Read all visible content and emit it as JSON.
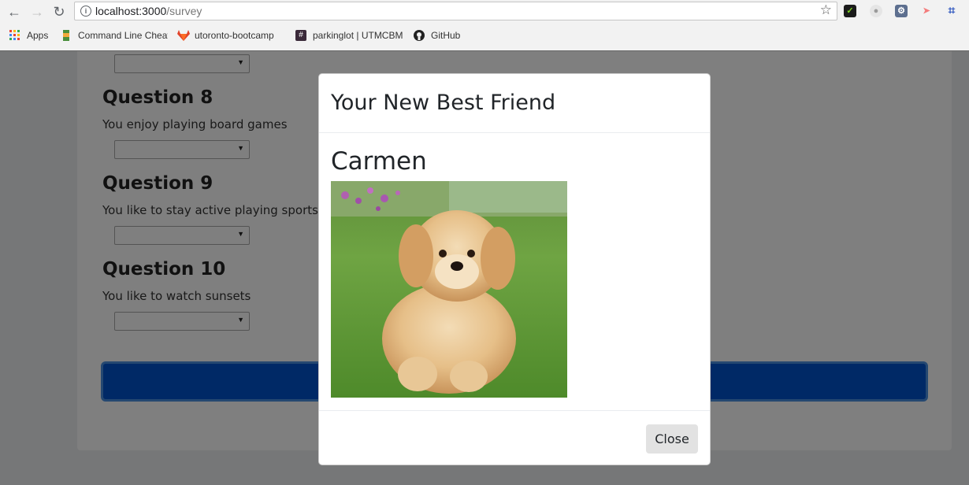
{
  "browser": {
    "url_host": "localhost:3000",
    "url_path": "/survey",
    "bookmarks": [
      {
        "label": "Apps",
        "icon": "apps-grid-icon"
      },
      {
        "label": "Command Line Cheat",
        "icon": "bookmark-icon"
      },
      {
        "label": "utoronto-bootcamp",
        "icon": "gitlab-icon"
      },
      {
        "label": "parkinglot | UTMCBM",
        "icon": "slack-hash-icon"
      },
      {
        "label": "GitHub",
        "icon": "github-icon"
      }
    ],
    "colors": {
      "toolbar": "#f2f2f2",
      "omnibox_border": "#c5c5c5"
    }
  },
  "survey": {
    "questions": [
      {
        "title": "Question 8",
        "text": "You enjoy playing board games"
      },
      {
        "title": "Question 9",
        "text": "You like to stay active playing sports"
      },
      {
        "title": "Question 10",
        "text": "You like to watch sunsets"
      }
    ],
    "submit_color": "#0052cc"
  },
  "modal": {
    "title": "Your New Best Friend",
    "friend_name": "Carmen",
    "photo_subject": "golden doodle puppy sitting on grass",
    "close_label": "Close"
  }
}
